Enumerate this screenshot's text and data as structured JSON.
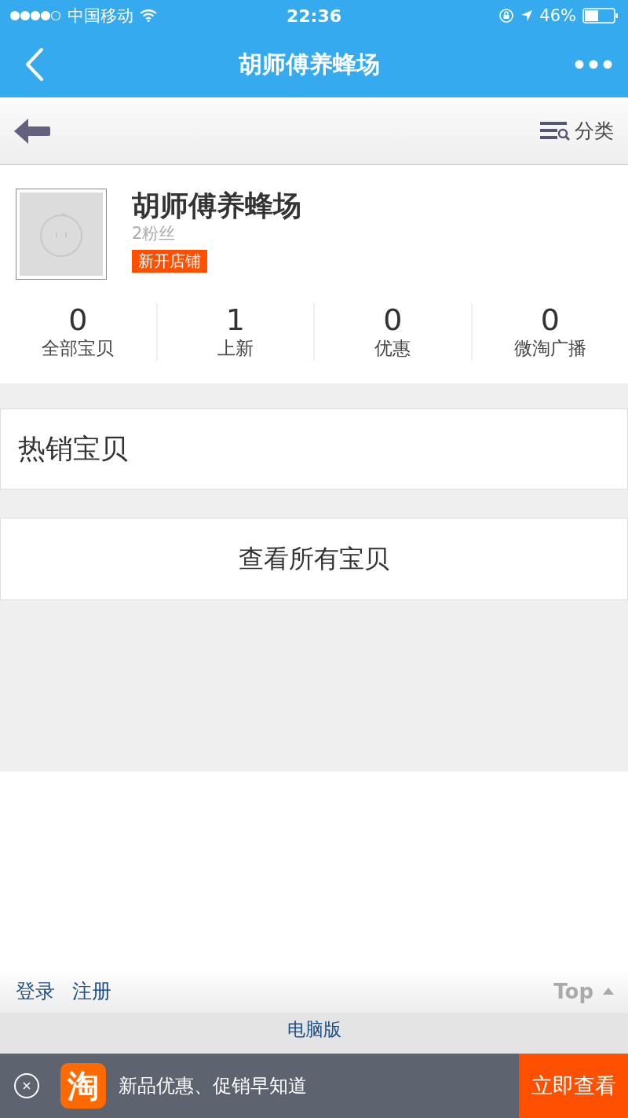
{
  "status_bar": {
    "carrier": "中国移动",
    "time": "22:36",
    "battery": "46%"
  },
  "nav": {
    "title": "胡师傅养蜂场"
  },
  "toolbar": {
    "category": "分类"
  },
  "shop": {
    "name": "胡师傅养蜂场",
    "followers": "2粉丝",
    "badge": "新开店铺"
  },
  "stats": [
    {
      "value": "0",
      "label": "全部宝贝"
    },
    {
      "value": "1",
      "label": "上新"
    },
    {
      "value": "0",
      "label": "优惠"
    },
    {
      "value": "0",
      "label": "微淘广播"
    }
  ],
  "hot_section": {
    "title": "热销宝贝"
  },
  "view_all": "查看所有宝贝",
  "footer": {
    "links": [
      "登录",
      "注册"
    ],
    "top": "Top",
    "desktop": "电脑版"
  },
  "banner": {
    "logo": "淘",
    "text": "新品优惠、促销早知道",
    "button": "立即查看"
  }
}
